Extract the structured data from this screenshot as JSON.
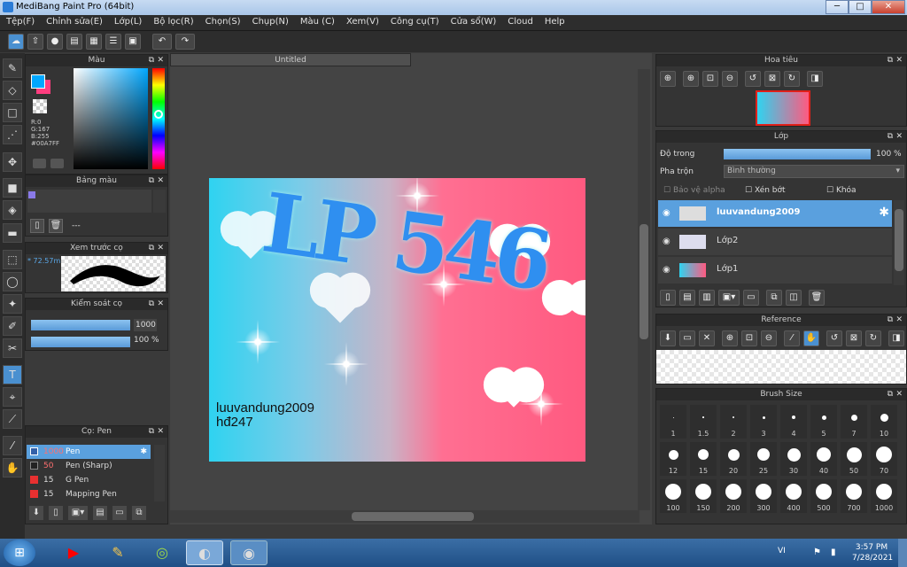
{
  "window": {
    "title": "MediBang Paint Pro (64bit)"
  },
  "menu": [
    "Tệp(F)",
    "Chỉnh sửa(E)",
    "Lớp(L)",
    "Bộ lọc(R)",
    "Chọn(S)",
    "Chụp(N)",
    "Màu (C)",
    "Xem(V)",
    "Công cụ(T)",
    "Cửa sổ(W)",
    "Cloud",
    "Help"
  ],
  "color_panel": {
    "title": "Màu",
    "r": "R:0",
    "g": "G:167",
    "b": "B:255",
    "hex": "#00A7FF",
    "main_color": "#00a7ff",
    "sub_color": "#ff3d7f"
  },
  "palette_panel": {
    "title": "Bảng màu",
    "value": "---"
  },
  "brush_preview": {
    "title": "Xem trước cọ",
    "size": "72.57m"
  },
  "brush_control": {
    "title": "Kiểm soát cọ",
    "size": "1000",
    "opacity": "100 %"
  },
  "brush_list": {
    "title": "Cọ: Pen",
    "items": [
      {
        "size": "1000",
        "name": "Pen",
        "selected": true
      },
      {
        "size": "50",
        "name": "Pen (Sharp)"
      },
      {
        "size": "15",
        "name": "G Pen"
      },
      {
        "size": "15",
        "name": "Mapping Pen"
      }
    ]
  },
  "canvas": {
    "tab": "Untitled",
    "text_line1": "luuvandung2009",
    "text_line2": "hđ247",
    "art_text": "LP 546"
  },
  "navigator": {
    "title": "Hoa tiêu"
  },
  "layer_panel": {
    "title": "Lớp",
    "opacity_label": "Độ trong",
    "opacity_value": "100 %",
    "blend_label": "Pha trộn",
    "blend_value": "Bình thường",
    "protect_alpha": "Bảo vệ alpha",
    "clip": "Xén bớt",
    "lock": "Khóa",
    "layers": [
      {
        "name": "luuvandung2009",
        "selected": true
      },
      {
        "name": "Lớp2"
      },
      {
        "name": "Lớp1"
      }
    ]
  },
  "reference": {
    "title": "Reference"
  },
  "brush_size": {
    "title": "Brush Size",
    "sizes": [
      "1",
      "1.5",
      "2",
      "3",
      "4",
      "5",
      "7",
      "10",
      "12",
      "15",
      "20",
      "25",
      "30",
      "40",
      "50",
      "70",
      "100",
      "150",
      "200",
      "300",
      "400",
      "500",
      "700",
      "1000"
    ]
  },
  "taskbar": {
    "lang": "VI",
    "time": "3:57 PM",
    "date": "7/28/2021"
  }
}
